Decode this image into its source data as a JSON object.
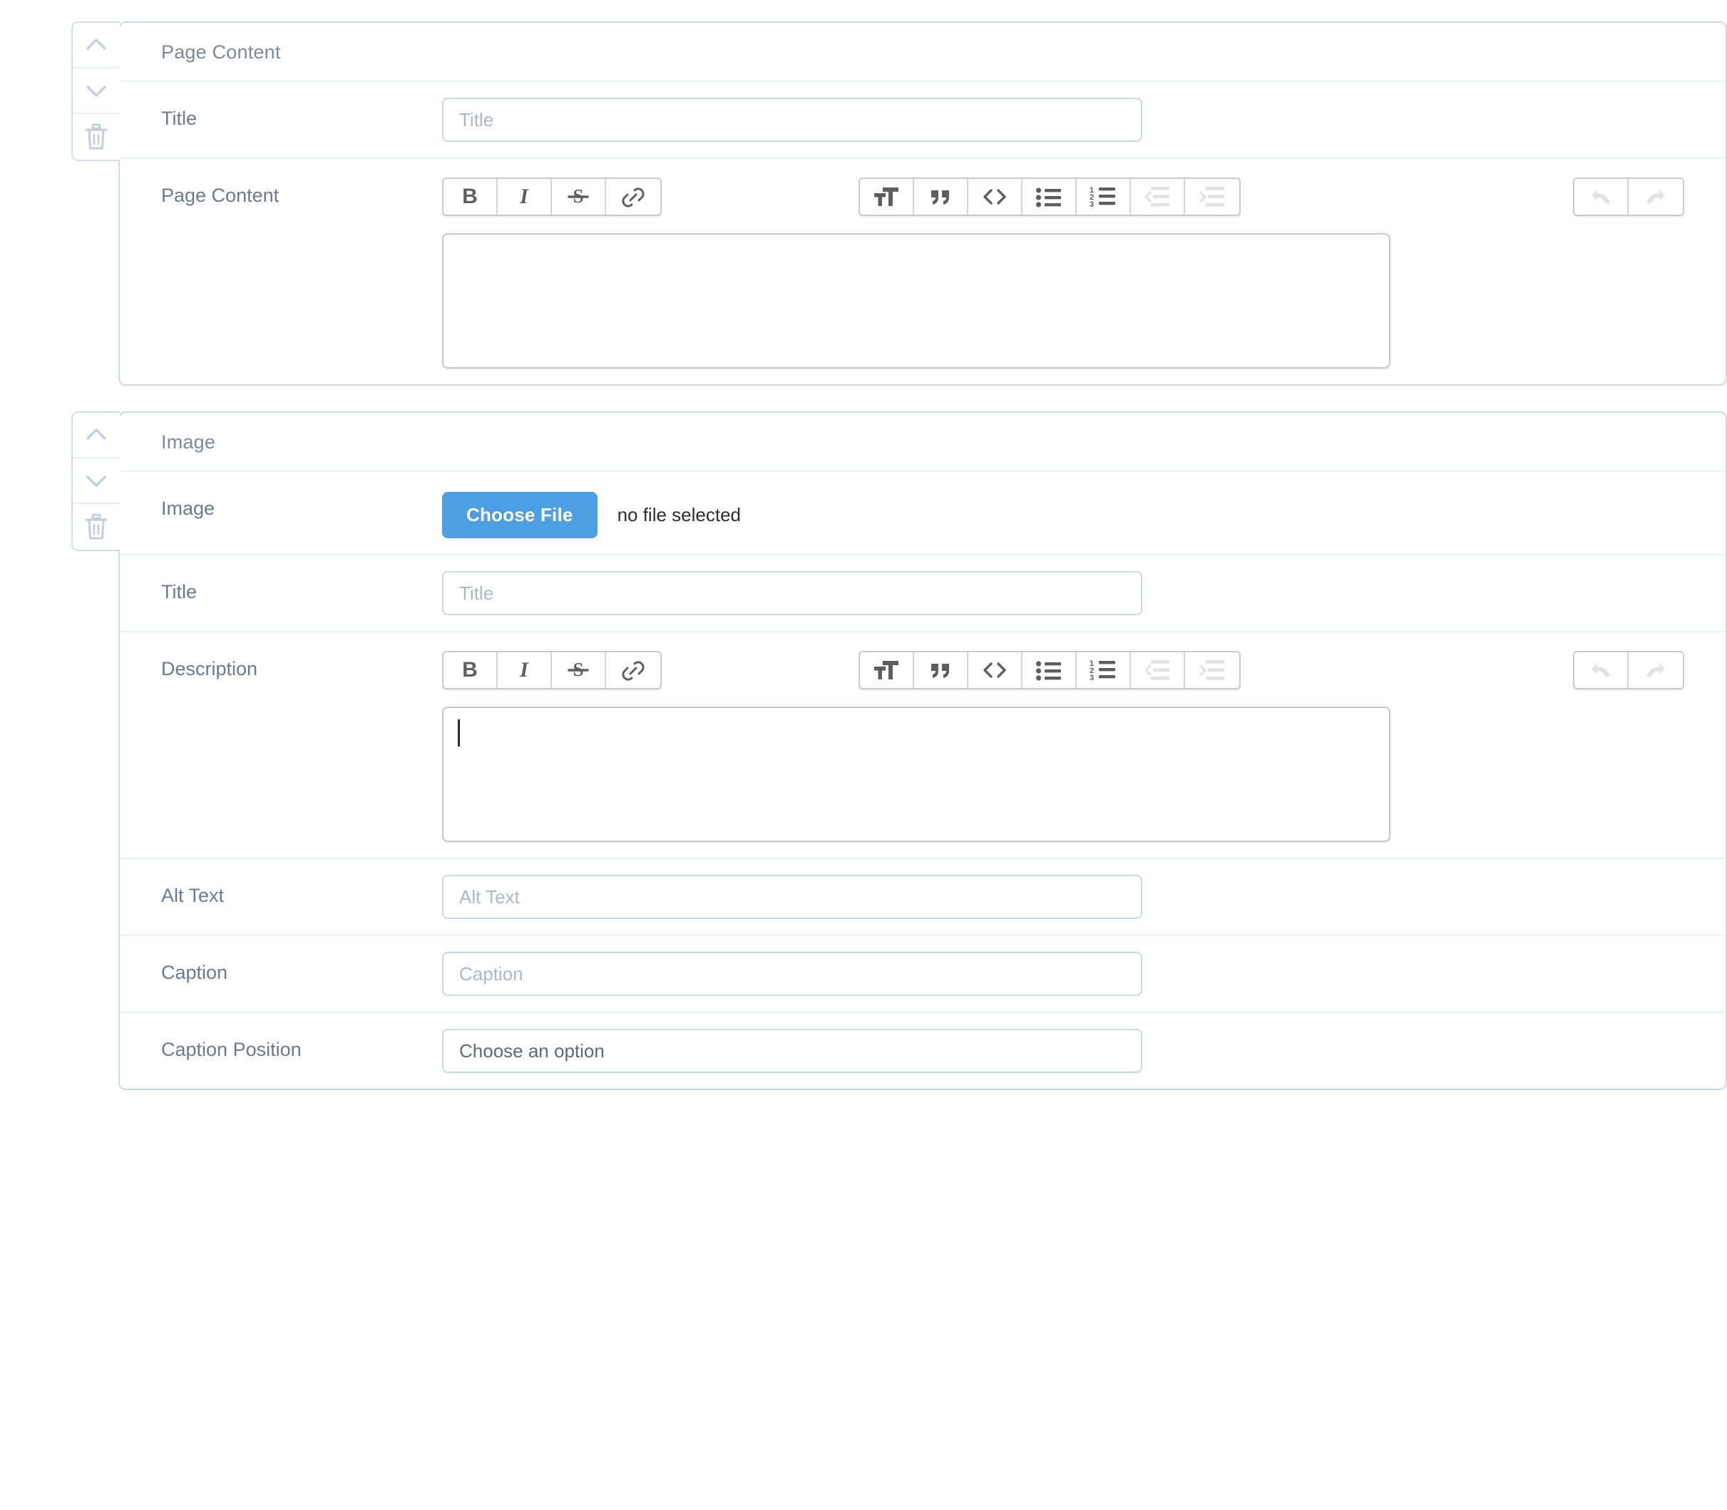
{
  "blocks": [
    {
      "header": "Page Content",
      "rail": {
        "move_up": "move-up",
        "move_down": "move-down",
        "delete": "delete"
      },
      "rows": [
        {
          "label": "Title",
          "type": "text",
          "value": "",
          "placeholder": "Title"
        },
        {
          "label": "Page Content",
          "type": "richtext",
          "value": "",
          "focused": false
        }
      ]
    },
    {
      "header": "Image",
      "rail": {
        "move_up": "move-up",
        "move_down": "move-down",
        "delete": "delete"
      },
      "rows": [
        {
          "label": "Image",
          "type": "file",
          "button_label": "Choose File",
          "status": "no file selected"
        },
        {
          "label": "Title",
          "type": "text",
          "value": "",
          "placeholder": "Title"
        },
        {
          "label": "Description",
          "type": "richtext",
          "value": "",
          "focused": true
        },
        {
          "label": "Alt Text",
          "type": "text",
          "value": "",
          "placeholder": "Alt Text"
        },
        {
          "label": "Caption",
          "type": "text",
          "value": "",
          "placeholder": "Caption"
        },
        {
          "label": "Caption Position",
          "type": "select",
          "value": "Choose an option"
        }
      ]
    }
  ],
  "toolbar": {
    "group1": [
      {
        "name": "bold",
        "label": "B"
      },
      {
        "name": "italic",
        "label": "I"
      },
      {
        "name": "strikethrough",
        "label": "S"
      },
      {
        "name": "link",
        "label": ""
      }
    ],
    "group2": [
      {
        "name": "heading",
        "label": ""
      },
      {
        "name": "blockquote",
        "label": ""
      },
      {
        "name": "code",
        "label": ""
      },
      {
        "name": "bulleted-list",
        "label": ""
      },
      {
        "name": "numbered-list",
        "label": ""
      },
      {
        "name": "outdent",
        "label": "",
        "disabled": true
      },
      {
        "name": "indent",
        "label": "",
        "disabled": true
      }
    ],
    "group3": [
      {
        "name": "undo",
        "label": "",
        "disabled": true
      },
      {
        "name": "redo",
        "label": "",
        "disabled": true
      }
    ],
    "numbered_list_digits": [
      "1",
      "2",
      "3"
    ]
  },
  "colors": {
    "accent": "#4d9fe3",
    "card_border": "#cdd9e4",
    "row_divider": "#eef1f4",
    "label_text": "#6b7b8b",
    "placeholder": "#adb8c3",
    "toolbar_icon": "#5e5e5e",
    "toolbar_icon_disabled": "#e2e2e2",
    "rail_icon": "#c3d0dc"
  }
}
